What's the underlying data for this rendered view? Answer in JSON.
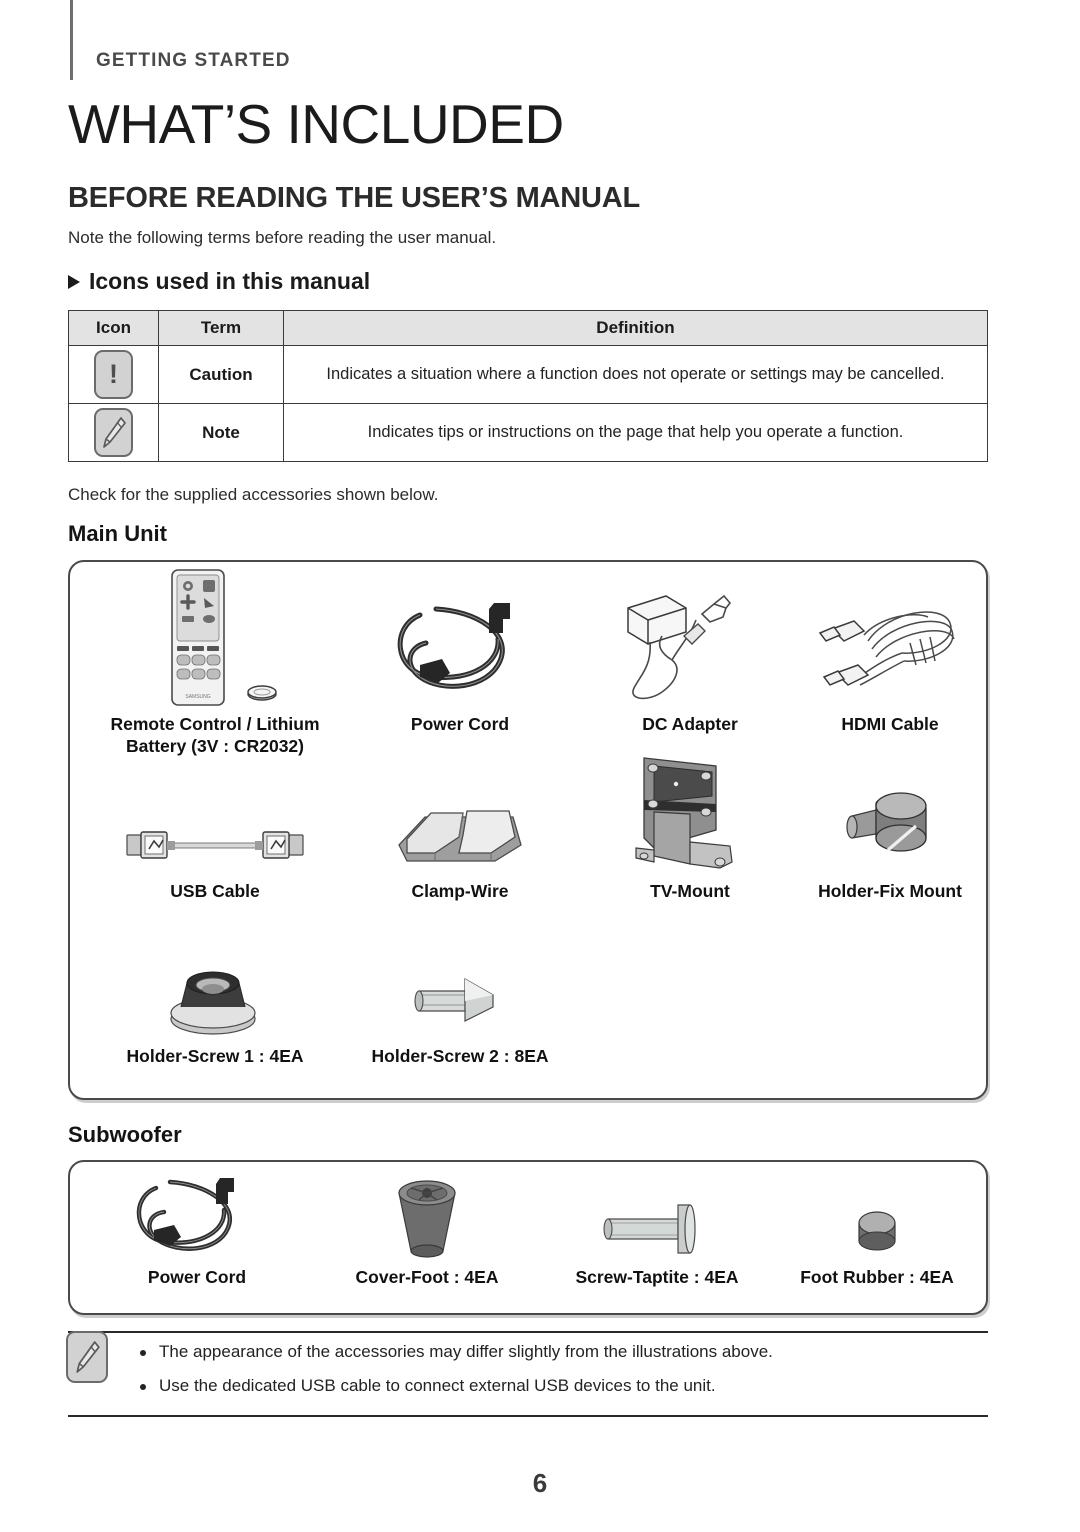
{
  "header": {
    "kicker": "GETTING STARTED",
    "chapter_title": "WHAT’S INCLUDED",
    "section_title": "BEFORE READING THE USER’S MANUAL",
    "section_intro": "Note the following terms before reading the user manual.",
    "sub_head": "Icons used in this manual"
  },
  "icon_table": {
    "columns": [
      "Icon",
      "Term",
      "Definition"
    ],
    "rows": [
      {
        "icon": "caution-icon",
        "term": "Caution",
        "definition": "Indicates a situation where a function does not operate or settings may be cancelled."
      },
      {
        "icon": "note-pencil-icon",
        "term": "Note",
        "definition": "Indicates tips or instructions on the page that help you operate a function."
      }
    ]
  },
  "accessories": {
    "lead_note": "Check for the supplied accessories shown below.",
    "main_unit": {
      "label": "Main Unit",
      "items": [
        {
          "name": "remote-control",
          "caption": "Remote Control / Lithium\nBattery (3V : CR2032)"
        },
        {
          "name": "power-cord",
          "caption": "Power Cord"
        },
        {
          "name": "dc-adapter",
          "caption": "DC Adapter"
        },
        {
          "name": "hdmi-cable",
          "caption": "HDMI Cable"
        },
        {
          "name": "usb-cable",
          "caption": "USB Cable"
        },
        {
          "name": "clamp-wire",
          "caption": "Clamp-Wire"
        },
        {
          "name": "tv-mount",
          "caption": "TV-Mount"
        },
        {
          "name": "holder-fix-mount",
          "caption": "Holder-Fix Mount"
        },
        {
          "name": "holder-screw-1",
          "caption": "Holder-Screw 1 : 4EA"
        },
        {
          "name": "holder-screw-2",
          "caption": "Holder-Screw 2 : 8EA"
        }
      ]
    },
    "subwoofer": {
      "label": "Subwoofer",
      "items": [
        {
          "name": "sub-power-cord",
          "caption": "Power Cord"
        },
        {
          "name": "cover-foot",
          "caption": "Cover-Foot : 4EA"
        },
        {
          "name": "screw-taptite",
          "caption": "Screw-Taptite : 4EA"
        },
        {
          "name": "foot-rubber",
          "caption": "Foot Rubber : 4EA"
        }
      ]
    }
  },
  "footer_note": {
    "icon": "note-pencil-icon",
    "bullets": [
      "The appearance of the accessories may differ slightly from the illustrations above.",
      "Use the dedicated USB cable to connect external USB devices to the unit."
    ]
  },
  "page_number": "6",
  "colors": {
    "text": "#1a1a1a",
    "kicker": "#4a4a4a",
    "table_header_bg": "#e3e3e3",
    "rule": "#2a2a2a",
    "box_border": "#4a4a4a"
  }
}
